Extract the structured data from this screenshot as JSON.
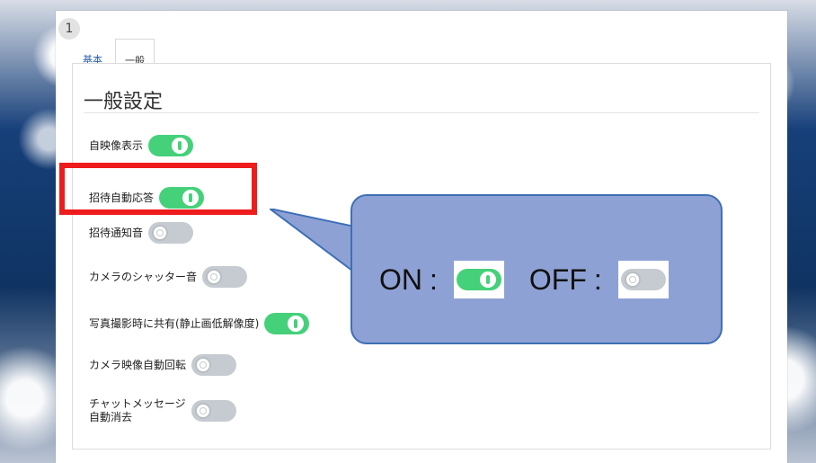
{
  "step_number": "1",
  "tabs": [
    {
      "label": "基本"
    },
    {
      "label": "一般"
    }
  ],
  "panel_title": "一般設定",
  "settings": [
    {
      "label": "自映像表示",
      "state": "on"
    },
    {
      "label": "招待自動応答",
      "state": "on"
    },
    {
      "label": "招待通知音",
      "state": "off"
    },
    {
      "label": "カメラのシャッター音",
      "state": "off"
    },
    {
      "label": "写真撮影時に共有(静止画低解像度)",
      "state": "on"
    },
    {
      "label": "カメラ映像自動回転",
      "state": "off"
    },
    {
      "label": "チャットメッセージ\n自動消去",
      "state": "off"
    }
  ],
  "callout": {
    "on_label": "ON",
    "off_label": "OFF",
    "separator": ":"
  },
  "colors": {
    "toggle_on": "#45d17a",
    "toggle_off": "#c6cbd1",
    "highlight": "#ee1c1c",
    "callout_fill": "#8ea1d4",
    "callout_border": "#3f6fb6"
  }
}
